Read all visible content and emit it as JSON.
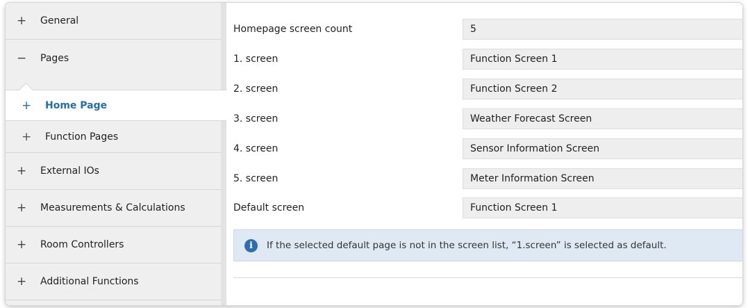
{
  "sidebar": {
    "items": [
      {
        "symbol": "+",
        "label": "General"
      },
      {
        "symbol": "−",
        "label": "Pages"
      },
      {
        "symbol": "+",
        "label": "External IOs"
      },
      {
        "symbol": "+",
        "label": "Measurements & Calculations"
      },
      {
        "symbol": "+",
        "label": "Room Controllers"
      },
      {
        "symbol": "+",
        "label": "Additional Functions"
      }
    ],
    "sub_items": [
      {
        "symbol": "+",
        "label": "Home Page",
        "active": true
      },
      {
        "symbol": "+",
        "label": "Function Pages",
        "active": false
      }
    ]
  },
  "settings": [
    {
      "label": "Homepage screen count",
      "value": "5"
    },
    {
      "label": "1. screen",
      "value": "Function Screen 1"
    },
    {
      "label": "2. screen",
      "value": "Function Screen 2"
    },
    {
      "label": "3. screen",
      "value": "Weather Forecast Screen"
    },
    {
      "label": "4. screen",
      "value": "Sensor Information Screen"
    },
    {
      "label": "5. screen",
      "value": "Meter Information Screen"
    },
    {
      "label": "Default screen",
      "value": "Function Screen 1"
    }
  ],
  "info": {
    "icon": "info-icon",
    "text": "If the selected default page is not in the screen list, “1.screen” is selected as default."
  },
  "colors": {
    "accent": "#1f6fb2",
    "info_bg": "#dfe9f3",
    "sidebar_bg": "#efefef"
  }
}
